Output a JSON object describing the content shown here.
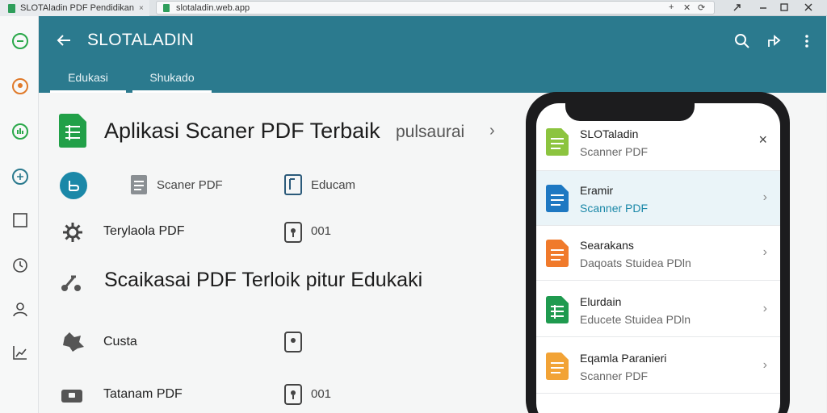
{
  "browser": {
    "tab_title": "SLOTAladin PDF Pendidikan",
    "tab_close": "×",
    "url": "slotaladin.web.app",
    "url_buttons": [
      "+",
      "✕",
      "⟳"
    ]
  },
  "app": {
    "title": "SLOTALADIN",
    "tabs": [
      {
        "label": "Edukasi",
        "active": true
      },
      {
        "label": "Shukado",
        "active": false
      }
    ]
  },
  "main": {
    "hero_title": "Aplikasi Scaner PDF Terbaik",
    "hero_subtitle": "pulsaurai",
    "hero_chevron": "›",
    "row1": {
      "pill": "Scaner PDF",
      "pill2": "Educam"
    },
    "row2": {
      "label": "Terylaola PDF",
      "value": "001"
    },
    "heading2": "Scaikasai PDF Terloik pitur Edukaki",
    "row3": {
      "label": "Custa"
    },
    "row4": {
      "label": "Tatanam PDF",
      "value": "001"
    }
  },
  "phone": {
    "close": "×",
    "items": [
      {
        "title": "SLOTaladin",
        "subtitle": "Scanner PDF",
        "doc_color": "#8cc43f",
        "chevron": ""
      },
      {
        "title": "Eramir",
        "subtitle": "Scanner PDF",
        "doc_color": "#1e78c2",
        "chevron": "›",
        "selected": true
      },
      {
        "title": "Searakans",
        "subtitle": "Daqoats Stuidea PDln",
        "doc_color": "#f07a2b",
        "chevron": "›"
      },
      {
        "title": "Elurdain",
        "subtitle": "Educete Stuidea PDln",
        "doc_color": "#1f9a4f",
        "chevron": "›"
      },
      {
        "title": "Eqamla Paranieri",
        "subtitle": "Scanner PDF",
        "doc_color": "#f2a336",
        "chevron": "›"
      }
    ]
  },
  "colors": {
    "appbar": "#2b7a8e",
    "accent": "#1b88a8"
  }
}
